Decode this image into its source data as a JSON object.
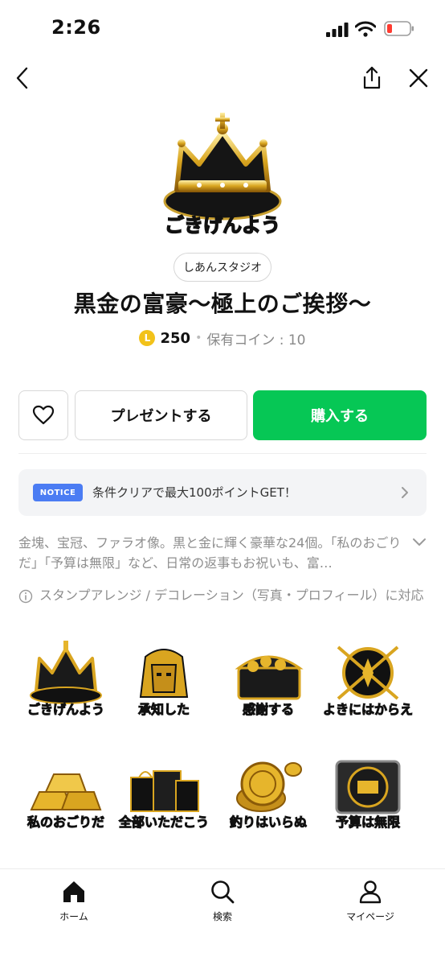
{
  "status_bar": {
    "time": "2:26"
  },
  "nav": {
    "back_icon": "chevron-left-icon",
    "share_icon": "share-icon",
    "close_icon": "close-icon"
  },
  "product": {
    "main_sticker_caption": "ごきげんよう",
    "author": "しあんスタジオ",
    "title": "黒金の富豪〜極上のご挨拶〜",
    "coin_symbol": "L",
    "price": "250",
    "owned_coins": "保有コイン : 10"
  },
  "actions": {
    "favorite_icon": "heart-icon",
    "gift_label": "プレゼントする",
    "buy_label": "購入する",
    "buy_color": "#06c755"
  },
  "notice": {
    "badge": "NOTICE",
    "text": "条件クリアで最大100ポイントGET！",
    "badge_color": "#4b7cf3"
  },
  "description": {
    "text": "金塊、宝冠、ファラオ像。黒と金に輝く豪華な24個。「私のおごりだ」「予算は無限」など、日常の返事もお祝いも、富…",
    "arrange_note": "スタンプアレンジ / デコレーション（写真・プロフィール）に対応"
  },
  "stickers": [
    {
      "caption": "ごきげんよう",
      "motif": "crown"
    },
    {
      "caption": "承知した",
      "motif": "pharaoh"
    },
    {
      "caption": "感謝する",
      "motif": "treasure-chest"
    },
    {
      "caption": "よきにはからえ",
      "motif": "emblem"
    },
    {
      "caption": "私のおごりだ",
      "motif": "gold-bars"
    },
    {
      "caption": "全部いただこう",
      "motif": "shopping-bags"
    },
    {
      "caption": "釣りはいらぬ",
      "motif": "gold-coins"
    },
    {
      "caption": "予算は無限",
      "motif": "vault"
    }
  ],
  "tabs": [
    {
      "label": "ホーム",
      "icon": "home-icon"
    },
    {
      "label": "検索",
      "icon": "search-icon"
    },
    {
      "label": "マイページ",
      "icon": "person-icon"
    }
  ]
}
